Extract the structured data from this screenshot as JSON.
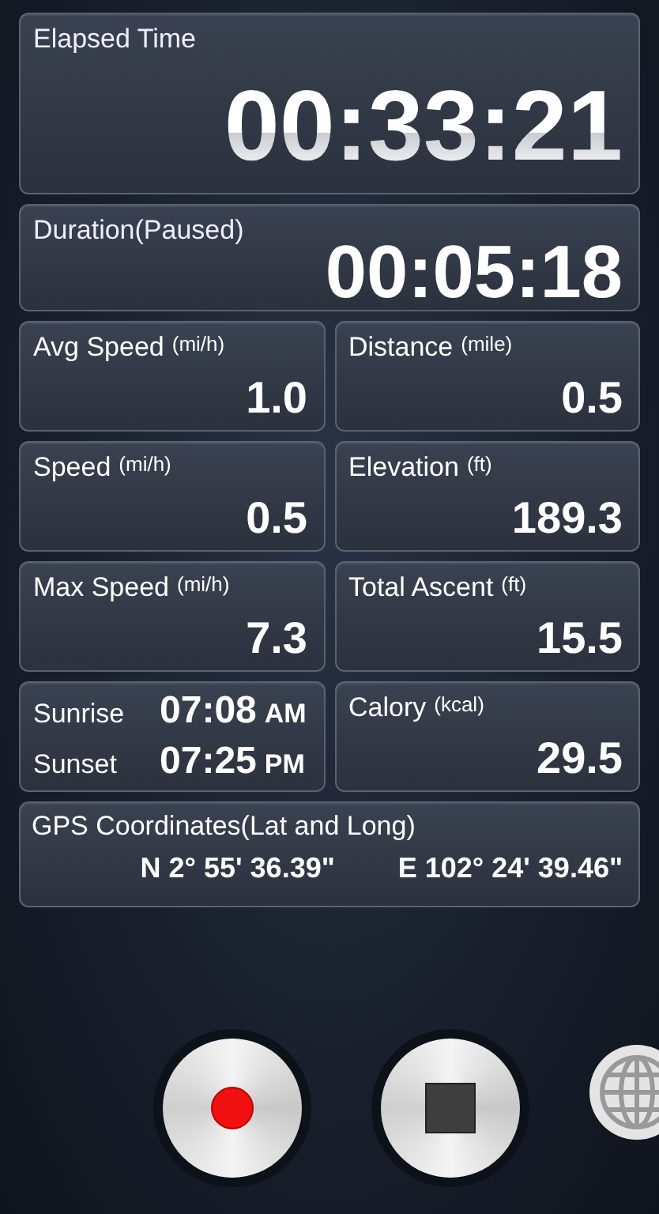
{
  "elapsed": {
    "label": "Elapsed Time",
    "value": "00:33:21"
  },
  "duration": {
    "label": "Duration(Paused)",
    "value": "00:05:18"
  },
  "metrics": [
    {
      "kind": "metric",
      "label": "Avg Speed",
      "unit": "(mi/h)",
      "value": "1.0"
    },
    {
      "kind": "metric",
      "label": "Distance",
      "unit": "(mile)",
      "value": "0.5"
    },
    {
      "kind": "metric",
      "label": "Speed",
      "unit": "(mi/h)",
      "value": "0.5"
    },
    {
      "kind": "metric",
      "label": "Elevation",
      "unit": "(ft)",
      "value": "189.3"
    },
    {
      "kind": "metric",
      "label": "Max Speed",
      "unit": "(mi/h)",
      "value": "7.3"
    },
    {
      "kind": "metric",
      "label": "Total Ascent",
      "unit": "(ft)",
      "value": "15.5"
    },
    {
      "kind": "sun",
      "rows": [
        {
          "label": "Sunrise",
          "time": "07:08",
          "period": "AM"
        },
        {
          "label": "Sunset",
          "time": "07:25",
          "period": "PM"
        }
      ]
    },
    {
      "kind": "metric",
      "label": "Calory",
      "unit": "(kcal)",
      "value": "29.5"
    }
  ],
  "gps": {
    "label": "GPS Coordinates(Lat and Long)",
    "latitude": "N 2° 55' 36.39\"",
    "longitude": "E 102° 24' 39.46\""
  },
  "controls": [
    {
      "kind": "record"
    },
    {
      "kind": "stop"
    },
    {
      "kind": "globe"
    }
  ]
}
